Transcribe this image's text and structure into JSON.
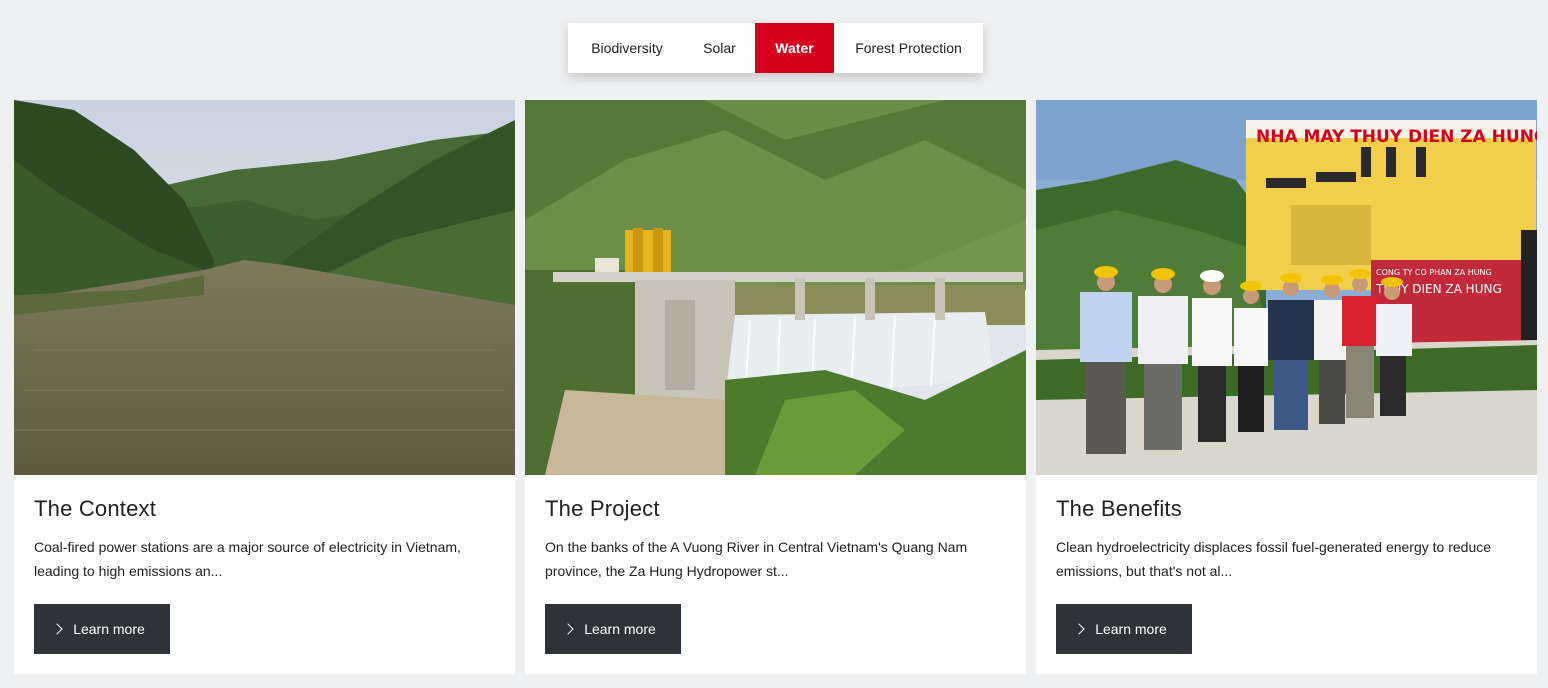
{
  "tabs": [
    {
      "label": "Biodiversity",
      "active": false
    },
    {
      "label": "Solar",
      "active": false
    },
    {
      "label": "Water",
      "active": true
    },
    {
      "label": "Forest Protection",
      "active": false
    }
  ],
  "accent_color": "#d5001c",
  "button_color": "#2f3236",
  "cards": [
    {
      "title": "The Context",
      "text": "Coal-fired power stations are a major source of electricity in Vietnam, leading to high emissions an...",
      "button_label": "Learn more",
      "button_icon": "chevron-right-icon",
      "image": "river-valley-photo"
    },
    {
      "title": "The Project",
      "text": "On the banks of the A Vuong River in Central Vietnam's Quang Nam province, the Za Hung Hydropower st...",
      "button_label": "Learn more",
      "button_icon": "chevron-right-icon",
      "image": "hydropower-dam-photo"
    },
    {
      "title": "The Benefits",
      "text": "Clean hydroelectricity displaces fossil fuel-generated energy to reduce emissions, but that's not al...",
      "button_label": "Learn more",
      "button_icon": "chevron-right-icon",
      "image": "team-at-power-plant-photo",
      "sign_text": "NHA MAY THUY DIEN ZA HUNG",
      "sign_text_small": "CONG TY CO PHAN ZA HUNG",
      "sign_text_board": "THUY DIEN ZA HUNG"
    }
  ]
}
